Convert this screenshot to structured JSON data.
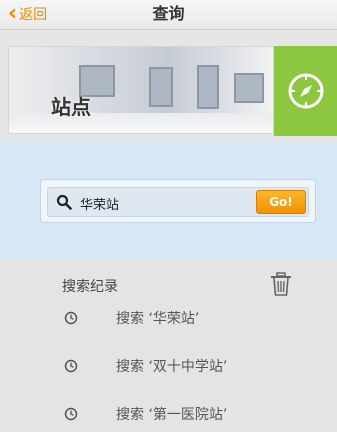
{
  "nav": {
    "back_label": "返回",
    "title": "查询"
  },
  "banner": {
    "title": "站点",
    "compass_icon": "compass-icon",
    "accent": "#8dc63f"
  },
  "search": {
    "value": "华荣站",
    "go_label": "Go!",
    "icon": "search-icon",
    "button_color": "#f29100"
  },
  "history": {
    "title": "搜索纪录",
    "clear_icon": "trash-icon",
    "items": [
      {
        "label": "搜索 ‘华荣站’"
      },
      {
        "label": "搜索 ‘双十中学站’"
      },
      {
        "label": "搜索 ‘第一医院站’"
      }
    ]
  }
}
